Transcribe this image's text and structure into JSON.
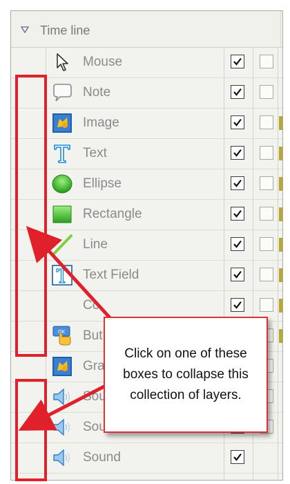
{
  "panel": {
    "title": "Time line"
  },
  "layers": [
    {
      "label": "Mouse",
      "icon": "mouse-cursor-icon",
      "visible": true,
      "locked": false
    },
    {
      "label": "Note",
      "icon": "note-bubble-icon",
      "visible": true,
      "locked": false
    },
    {
      "label": "Image",
      "icon": "image-icon",
      "visible": true,
      "locked": false
    },
    {
      "label": "Text",
      "icon": "text-icon",
      "visible": true,
      "locked": false
    },
    {
      "label": "Ellipse",
      "icon": "ellipse-icon",
      "visible": true,
      "locked": false
    },
    {
      "label": "Rectangle",
      "icon": "rectangle-icon",
      "visible": true,
      "locked": false
    },
    {
      "label": "Line",
      "icon": "line-icon",
      "visible": true,
      "locked": false
    },
    {
      "label": "Text Field",
      "icon": "text-field-icon",
      "visible": true,
      "locked": false
    },
    {
      "label": "Co",
      "icon": "",
      "visible": true,
      "locked": false
    },
    {
      "label": "But",
      "icon": "button-icon",
      "visible": true,
      "locked": false
    },
    {
      "label": "Gra",
      "icon": "image-icon",
      "visible": true,
      "locked": false
    },
    {
      "label": "Sou",
      "icon": "speaker-icon",
      "visible": true,
      "locked": false
    },
    {
      "label": "Sou",
      "icon": "speaker-icon",
      "visible": true,
      "locked": false
    },
    {
      "label": "Sound",
      "icon": "speaker-icon",
      "visible": true,
      "locked": null
    }
  ],
  "callout": {
    "text": "Click on one of these boxes to collapse this collection of layers."
  },
  "colors": {
    "annotation_red": "#e0202a",
    "panel_bg": "#f2f2ef",
    "icon_blue": "#1a8bd8",
    "icon_green": "#3fbf2f"
  }
}
